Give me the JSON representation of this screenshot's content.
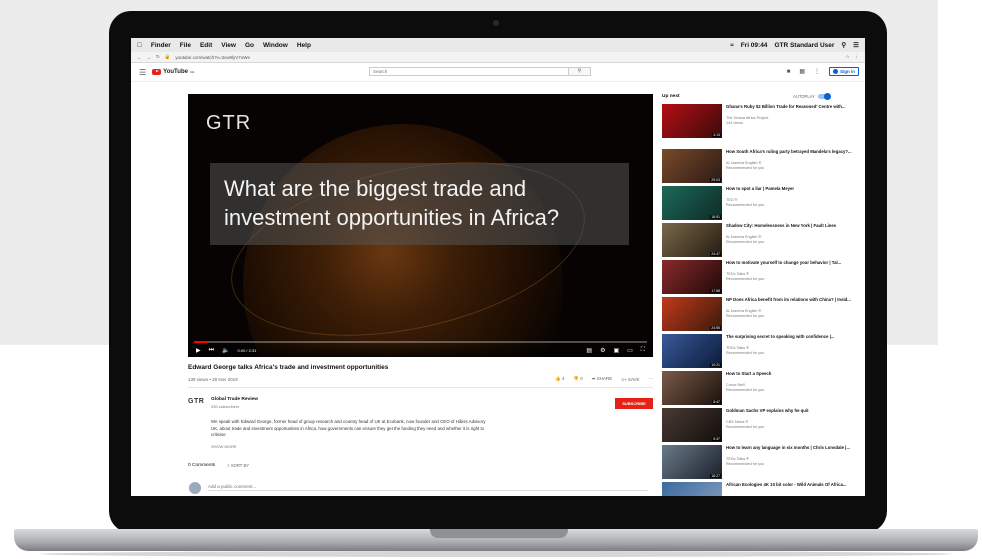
{
  "menubar": {
    "items": [
      "Finder",
      "File",
      "Edit",
      "View",
      "Go",
      "Window",
      "Help"
    ],
    "clock": "Fri 09:44",
    "user": "GTR Standard User"
  },
  "browser": {
    "url": "youtube.com/watch?v=3vw8lyV7uWe"
  },
  "yt_header": {
    "logo_text": "YouTube",
    "logo_suffix": "GB",
    "search_placeholder": "Search",
    "signin_label": "Sign in"
  },
  "player": {
    "watermark": "GTR",
    "overlay_title": "What are the biggest trade and investment opportunities in Africa?",
    "time": "0:00 / 2:31",
    "progress": 0.03
  },
  "video": {
    "title": "Edward George talks Africa's trade and investment opportunities",
    "meta": "139 views • 28 Nov 2019",
    "likes": "4",
    "dislikes": "0",
    "share": "SHARE",
    "save": "SAVE",
    "channel_logo": "GTR",
    "channel_name": "Global Trade Review",
    "subscribers": "330 subscribers",
    "subscribe": "SUBSCRIBE",
    "description": "We speak with Edward George, former head of group research and country head of UK at Ecobank, now founder and CEO of Hibiss Advisory UK, about trade and investment opportunities in Africa, how governments can ensure they get the funding they need and whether it is right to criticise",
    "show_more": "SHOW MORE",
    "comments": "0 Comments",
    "sort_by": "SORT BY",
    "comment_placeholder": "Add a public comment..."
  },
  "sidebar": {
    "up_next": "Up next",
    "autoplay": "AUTOPLAY",
    "items": [
      {
        "title": "Ghana's Ruby $2 Billion Trade for Reasoned' Centre with...",
        "channel": "The Ghana Africa Project",
        "sub": "144 views",
        "dur": "4:13",
        "c1": "#b30f14",
        "c2": "#3c0a0a"
      },
      {
        "title": "How South Africa's ruling party betrayed Mandela's legacy?...",
        "channel": "Al Jazeera English ®",
        "sub": "Recommended for you",
        "dur": "25:03",
        "c1": "#7a4a2a",
        "c2": "#2b1a14"
      },
      {
        "title": "How to spot a liar | Pamela Meyer",
        "channel": "TED ®",
        "sub": "Recommended for you",
        "dur": "18:51",
        "c1": "#1c6a5a",
        "c2": "#0e2a26"
      },
      {
        "title": "Shadow City: Homelessness in New York | Fault Lines",
        "channel": "Al Jazeera English ®",
        "sub": "Recommended for you",
        "dur": "24:47",
        "c1": "#7a6a4a",
        "c2": "#241a10"
      },
      {
        "title": "How to motivate yourself to change your behavior | Tal...",
        "channel": "TEDx Talks ®",
        "sub": "Recommended for you",
        "dur": "17:58",
        "c1": "#8a2a2a",
        "c2": "#200808"
      },
      {
        "title": "NP Does Africa benefit from its relations with China? | Insid...",
        "channel": "Al Jazeera English ®",
        "sub": "Recommended for you",
        "dur": "24:55",
        "c1": "#c23a1c",
        "c2": "#3a1a0a"
      },
      {
        "title": "The surprising secret to speaking with confidence |...",
        "channel": "TEDx Talks ®",
        "sub": "Recommended for you",
        "dur": "10:21",
        "c1": "#3a5a9a",
        "c2": "#0a1a3a"
      },
      {
        "title": "How to Start a Speech",
        "channel": "Conor Neill",
        "sub": "Recommended for you",
        "dur": "8:47",
        "c1": "#7a5a4a",
        "c2": "#1a120c"
      },
      {
        "title": "Goldman Sachs VP explains why he quit",
        "channel": "CBS News ®",
        "sub": "Recommended for you",
        "dur": "5:37",
        "c1": "#4a3a34",
        "c2": "#120e0c"
      },
      {
        "title": "How to learn any language in six months | Chris Lonsdale |...",
        "channel": "TEDx Talks ®",
        "sub": "Recommended for you",
        "dur": "18:27",
        "c1": "#6a7a8a",
        "c2": "#1a2028"
      },
      {
        "title": "African Ecologies 4K 10 bit color - Wild Animals Of Africa...",
        "channel": "",
        "sub": "",
        "dur": "",
        "c1": "#3a6aa0",
        "c2": "#8aa0c0"
      }
    ]
  }
}
